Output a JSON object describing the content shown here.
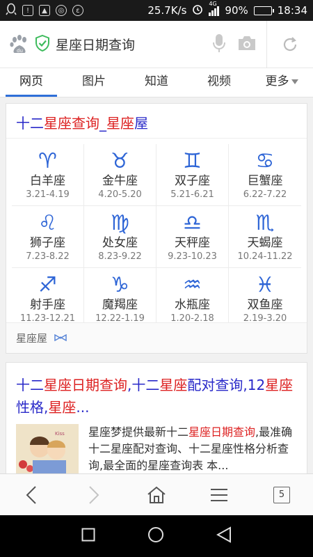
{
  "status_bar": {
    "network_speed": "25.7K/s",
    "network_type": "4G",
    "battery_percent": "90%",
    "battery_level": 0.9,
    "time": "18:34"
  },
  "search": {
    "query": "星座日期查询"
  },
  "tabs": [
    {
      "label": "网页",
      "active": true
    },
    {
      "label": "图片"
    },
    {
      "label": "知道"
    },
    {
      "label": "视频"
    },
    {
      "label": "更多"
    }
  ],
  "result1": {
    "title_parts": [
      "十二",
      "星座查询",
      "_",
      "星座",
      "屋"
    ],
    "zodiac": [
      {
        "symbol": "♈",
        "name": "白羊座",
        "dates": "3.21-4.19"
      },
      {
        "symbol": "♉",
        "name": "金牛座",
        "dates": "4.20-5.20"
      },
      {
        "symbol": "♊",
        "name": "双子座",
        "dates": "5.21-6.21"
      },
      {
        "symbol": "♋",
        "name": "巨蟹座",
        "dates": "6.22-7.22"
      },
      {
        "symbol": "♌",
        "name": "狮子座",
        "dates": "7.23-8.22"
      },
      {
        "symbol": "♍",
        "name": "处女座",
        "dates": "8.23-9.22"
      },
      {
        "symbol": "♎",
        "name": "天秤座",
        "dates": "9.23-10.23"
      },
      {
        "symbol": "♏",
        "name": "天蝎座",
        "dates": "10.24-11.22"
      },
      {
        "symbol": "♐",
        "name": "射手座",
        "dates": "11.23-12.21"
      },
      {
        "symbol": "♑",
        "name": "魔羯座",
        "dates": "12.22-1.19"
      },
      {
        "symbol": "♒",
        "name": "水瓶座",
        "dates": "1.20-2.18"
      },
      {
        "symbol": "♓",
        "name": "双鱼座",
        "dates": "2.19-3.20"
      }
    ],
    "source": "星座屋"
  },
  "result2": {
    "title_parts": [
      "十二",
      "星座日期查询",
      ",十二",
      "星座",
      "配对查询,12",
      "星座",
      "性格,",
      "星座",
      "..."
    ],
    "snippet_parts": [
      "星座梦提供最新十二",
      "星座日期查询",
      ",最准确十二星座配对查询、十二星座性格分析查询,最全面的星座查询表 本..."
    ]
  },
  "toolbar": {
    "tab_count": "5"
  },
  "colors": {
    "accent": "#2e6fd8",
    "link": "#2929c9",
    "highlight": "#d22222",
    "zodiac": "#2e65d6"
  }
}
